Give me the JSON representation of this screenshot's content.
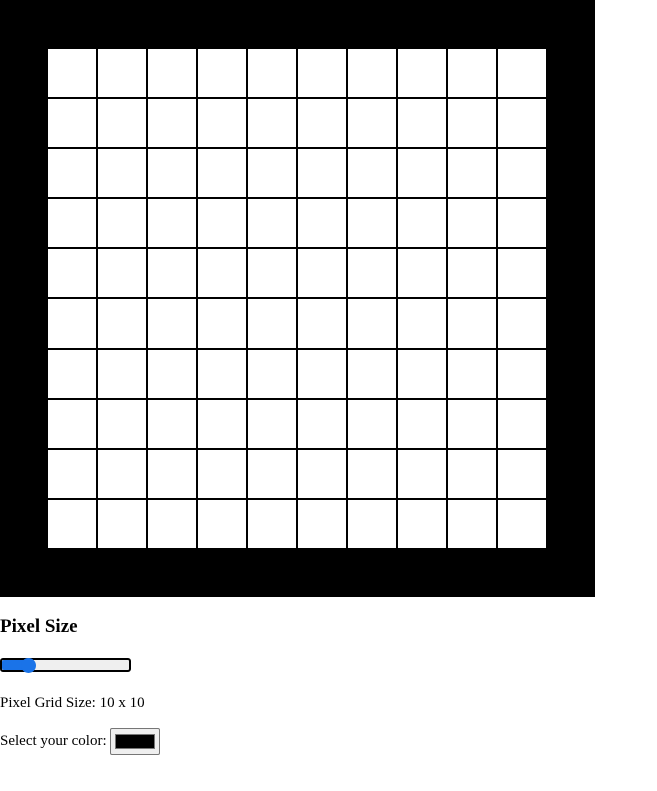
{
  "controls": {
    "heading": "Pixel Size",
    "slider": {
      "min": 1,
      "max": 50,
      "value": 10
    },
    "grid_size_label": "Pixel Grid Size: 10 x 10",
    "color_label": "Select your color:",
    "selected_color": "#000000"
  },
  "grid": {
    "columns": 10,
    "rows": 10,
    "cell_color": "#ffffff",
    "frame_color": "#000000"
  }
}
